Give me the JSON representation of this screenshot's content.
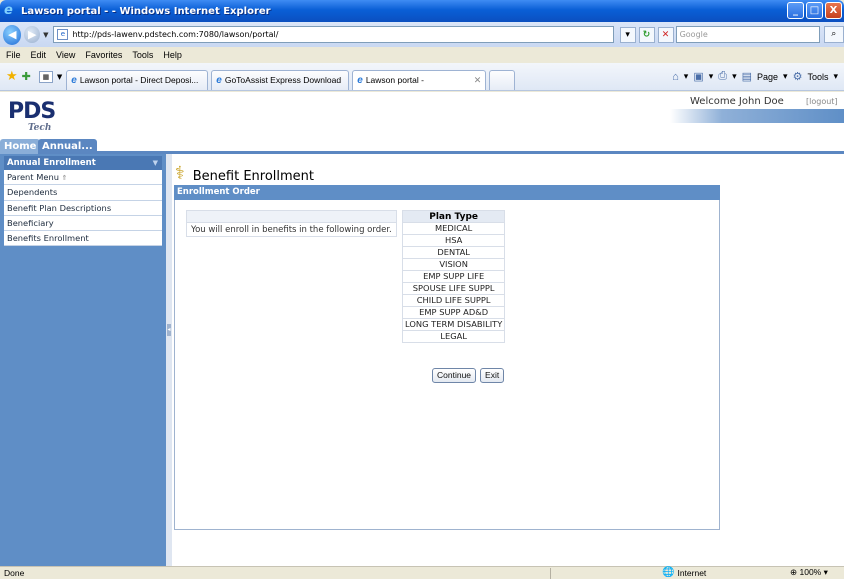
{
  "window": {
    "title": "Lawson portal - - Windows Internet Explorer",
    "buttons": [
      "_",
      "□",
      "X"
    ]
  },
  "addressbar": {
    "url": "http://pds-lawenv.pdstech.com:7080/lawson/portal/",
    "search_placeholder": "Google"
  },
  "menu": [
    "File",
    "Edit",
    "View",
    "Favorites",
    "Tools",
    "Help"
  ],
  "tabs": [
    {
      "label": "Lawson portal - Direct Deposi..."
    },
    {
      "label": "GoToAssist Express Download"
    },
    {
      "label": "Lawson portal -"
    }
  ],
  "command_bar": {
    "page_label": "Page",
    "tools_label": "Tools"
  },
  "portal": {
    "logo": "PDS",
    "logo_sub": "Tech",
    "welcome": "Welcome John Doe",
    "logout": "[logout]",
    "nav_tabs": [
      "Home",
      "Annual..."
    ]
  },
  "sidebar": {
    "header": "Annual Enrollment",
    "items": [
      {
        "label": "Parent Menu"
      },
      {
        "label": "Dependents"
      },
      {
        "label": "Benefit Plan Descriptions"
      },
      {
        "label": "Beneficiary"
      },
      {
        "label": "Benefits Enrollment"
      }
    ]
  },
  "main": {
    "title": "Benefit Enrollment",
    "panel_title": "Enrollment Order",
    "order_text": "You will enroll in benefits in the following order.",
    "plan_header": "Plan Type",
    "plan_types": [
      "MEDICAL",
      "HSA",
      "DENTAL",
      "VISION",
      "EMP SUPP LIFE",
      "SPOUSE LIFE SUPPL",
      "CHILD LIFE SUPPL",
      "EMP SUPP AD&D",
      "LONG TERM DISABILITY",
      "LEGAL"
    ],
    "continue_label": "Continue",
    "exit_label": "Exit"
  },
  "status": {
    "left": "Done",
    "zone": "Internet",
    "zoom": "100%"
  }
}
